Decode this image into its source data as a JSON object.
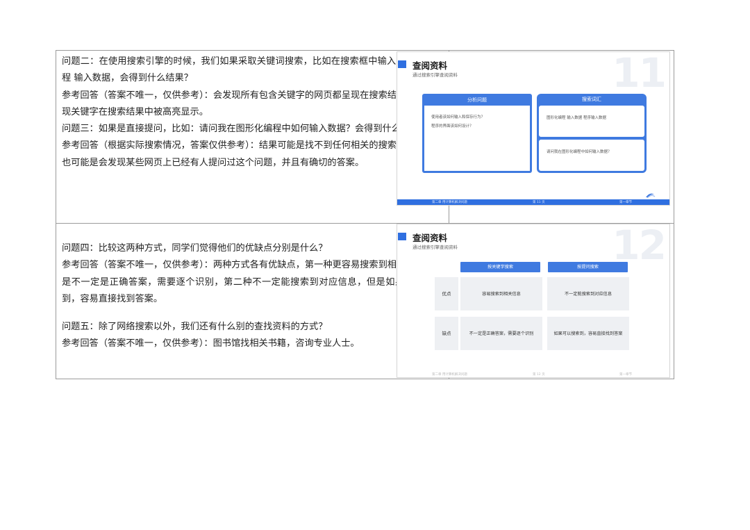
{
  "row1": {
    "paragraphs": [
      "问题二：在使用搜索引擎的时候，我们如果采取关键词搜索，比如在搜索框中输入：图形化编程 输入数据，会得到什么结果？",
      "参考回答（答案不唯一，仅供参考）：会发现所有包含关键字的网页都呈现在搜索结果中；会发现关键字在搜索结果中被高亮显示。",
      "问题三：如果是直接提问，比如：请问我在图形化编程中如何输入数据？会得到什么结果？",
      "参考回答（根据实际搜索情况，答案仅供参考）：结果可能是找不到任何相关的搜索结果。结果也可能是会发现某些网页上已经有人提问过这个问题，并且有确切的答案。"
    ]
  },
  "row2": {
    "paragraphs": [
      "问题四：比较这两种方式，同学们觉得他们的优缺点分别是什么？",
      "参考回答（答案不唯一，仅供参考）：两种方式各有优缺点，第一种更容易搜索到相关信息，但是不一定是正确答案，需要逐个识别，第二种不一定能搜索到对应信息，但是如果可以搜索到，容易直接找到答案。",
      "问题五：除了网络搜索以外，我们还有什么别的查找资料的方式？",
      "参考回答（答案不唯一，仅供参考）：图书馆找相关书籍，咨询专业人士。"
    ]
  },
  "slide1": {
    "title": "查阅资料",
    "subtitle": "通过搜索引擎查阅资料",
    "number": "11",
    "left_box": {
      "heading": "分析问题",
      "lines": [
        "使用者该如何输入和保存行为？",
        "程序的界面该如何设计？"
      ]
    },
    "right_box": {
      "heading": "搜索词汇",
      "item1": "图形化编程 输入数据 程序输入数据",
      "item2": "请问我在图形化编程中如何输入数据？"
    },
    "footer": {
      "left": "第二章 用计算机解决问题",
      "center": "第 11 页",
      "right": "第一章节"
    }
  },
  "slide2": {
    "title": "查阅资料",
    "subtitle": "通过搜索引擎查阅资料",
    "number": "12",
    "table": {
      "headers": [
        "按关键字搜索",
        "按提问搜索"
      ],
      "rows": [
        {
          "label": "优点",
          "cells": [
            "容易搜索到相关信息",
            "不一定能搜索到对应信息"
          ]
        },
        {
          "label": "缺点",
          "cells": [
            "不一定是正确答案，需要逐个识别",
            "如果可以搜索到，容易直接找到答案"
          ]
        }
      ]
    },
    "footer": {
      "left": "第二章 用计算机解决问题",
      "center": "第 12 页",
      "right": "第一章节"
    }
  },
  "colors": {
    "accent": "#3f7ae0",
    "border": "#9a9a9a",
    "cell_bg": "#eef0f3"
  }
}
